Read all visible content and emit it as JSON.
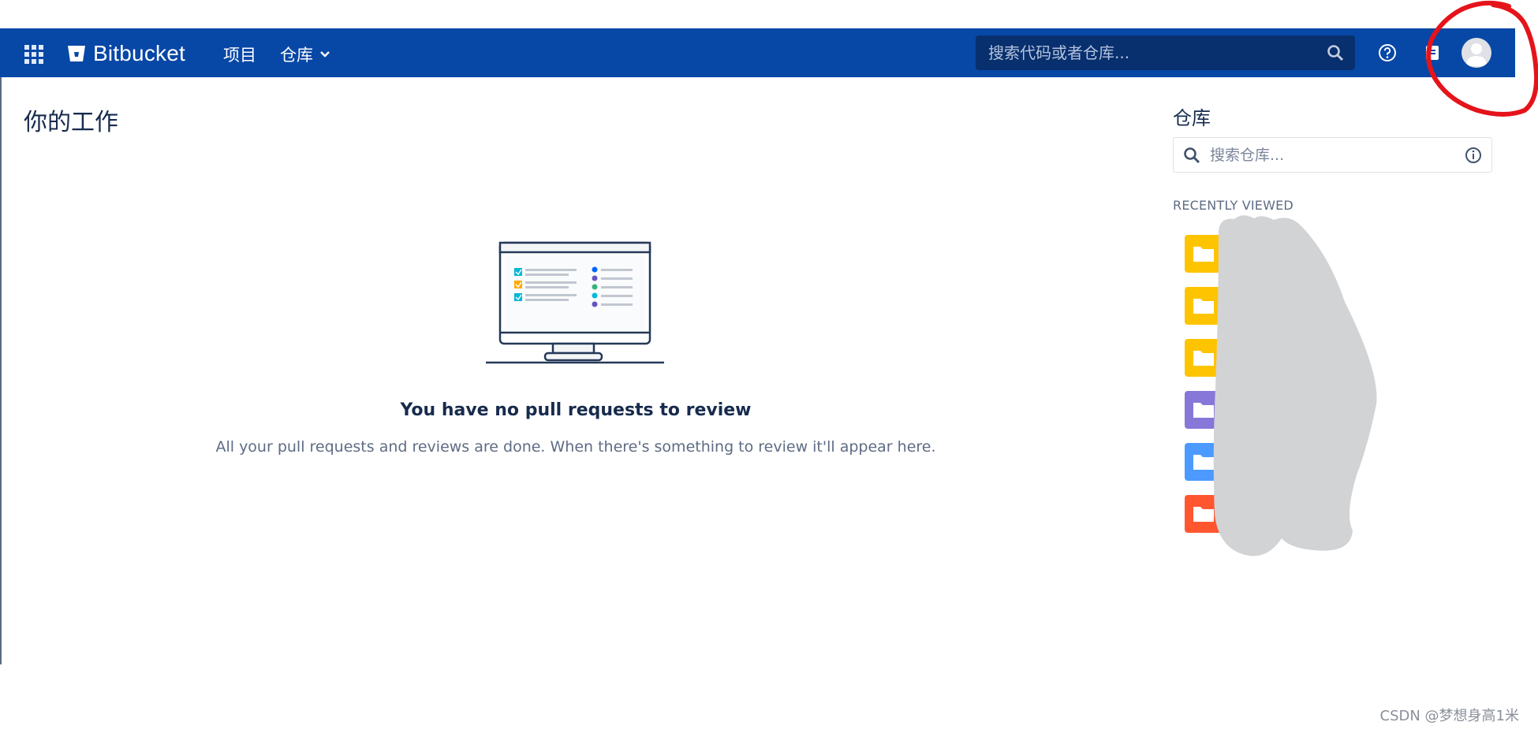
{
  "app": {
    "brand": "Bitbucket",
    "nav": {
      "projects": "项目",
      "repos": "仓库"
    },
    "search": {
      "placeholder": "搜索代码或者仓库..."
    }
  },
  "main": {
    "title": "你的工作",
    "empty_state": {
      "heading": "You have no pull requests to review",
      "description": "All your pull requests and reviews are done. When there's something to review it'll appear here."
    }
  },
  "sidebar": {
    "title": "仓库",
    "search_placeholder": "搜索仓库...",
    "recent_label": "RECENTLY VIEWED",
    "repos": [
      {
        "color": "#ffc400",
        "icon": "folder-icon"
      },
      {
        "color": "#ffc400",
        "icon": "folder-icon"
      },
      {
        "color": "#ffc400",
        "icon": "folder-icon"
      },
      {
        "color": "#8777d9",
        "icon": "folder-icon"
      },
      {
        "color": "#4c9aff",
        "icon": "folder-icon"
      },
      {
        "color": "#ff5630",
        "icon": "folder-icon"
      }
    ]
  },
  "colors": {
    "nav_bg": "#0747a6",
    "search_bg": "#082f6e",
    "annotation": "#e5141b"
  },
  "watermark": "CSDN @梦想身高1米"
}
